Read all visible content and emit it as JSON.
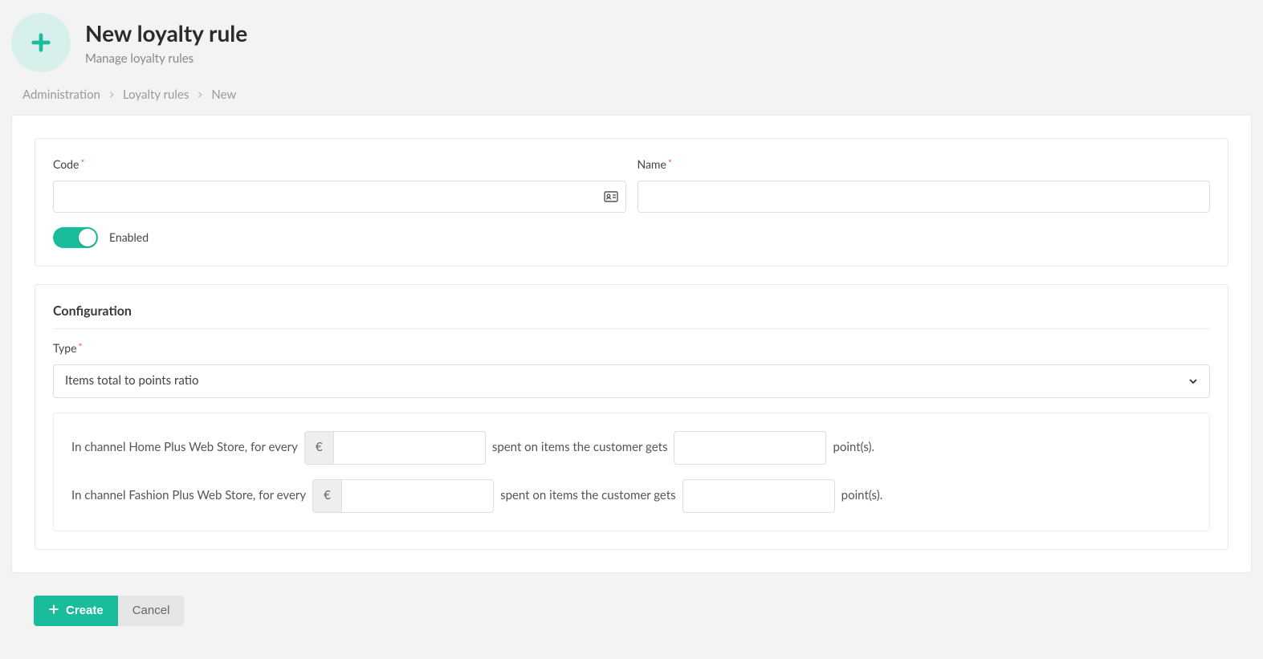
{
  "header": {
    "title": "New loyalty rule",
    "subtitle": "Manage loyalty rules"
  },
  "breadcrumb": {
    "items": [
      "Administration",
      "Loyalty rules",
      "New"
    ]
  },
  "form": {
    "code_label": "Code",
    "code_value": "",
    "name_label": "Name",
    "name_value": "",
    "enabled_label": "Enabled",
    "enabled": true
  },
  "configuration": {
    "section_title": "Configuration",
    "type_label": "Type",
    "type_selected": "Items total to points ratio",
    "channels": [
      {
        "prefix_text": "In channel Home Plus Web Store, for every",
        "currency": "€",
        "amount": "",
        "middle_text": "spent on items the customer gets",
        "points": "",
        "suffix_text": "point(s)."
      },
      {
        "prefix_text": "In channel Fashion Plus Web Store, for every",
        "currency": "€",
        "amount": "",
        "middle_text": "spent on items the customer gets",
        "points": "",
        "suffix_text": "point(s)."
      }
    ]
  },
  "actions": {
    "create_label": "Create",
    "cancel_label": "Cancel"
  }
}
